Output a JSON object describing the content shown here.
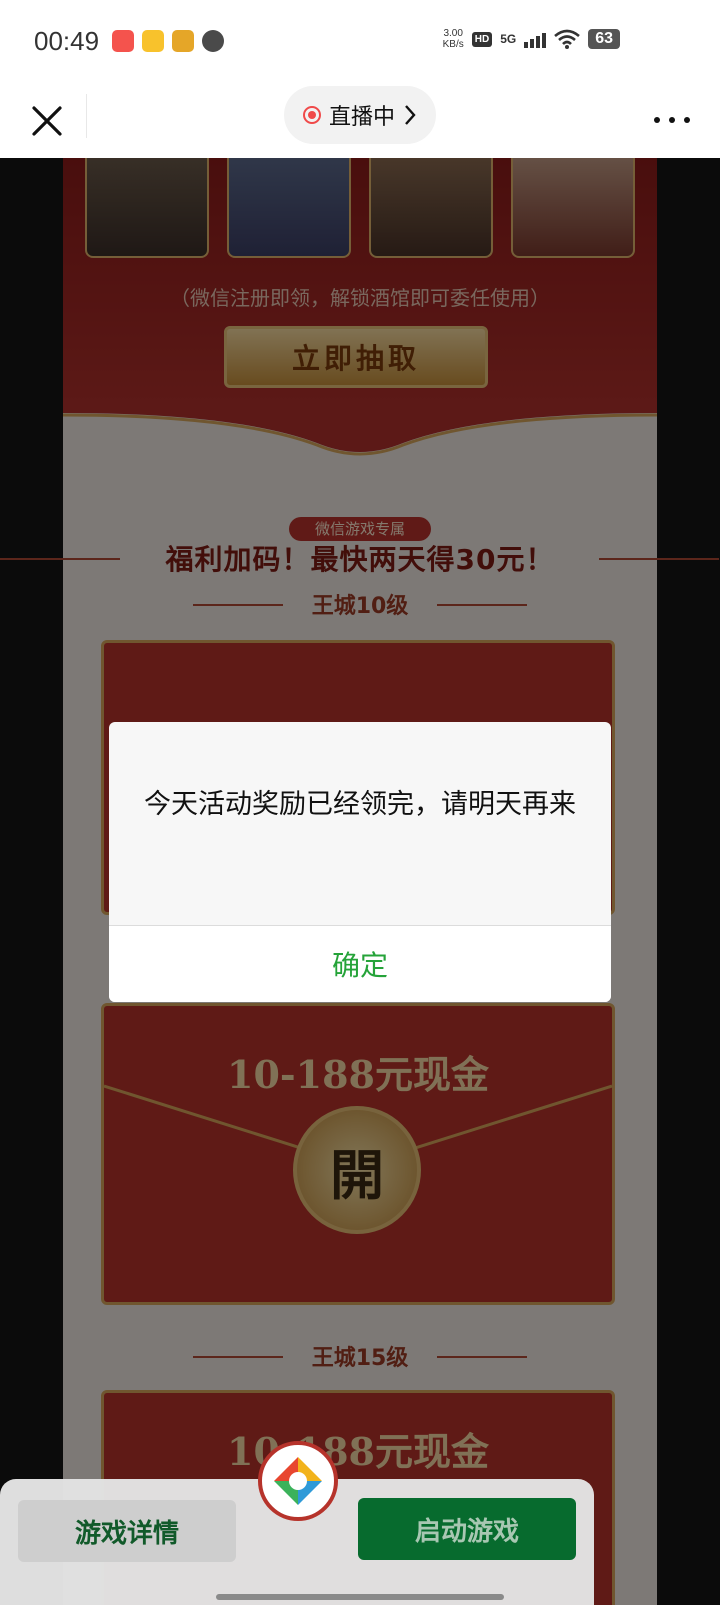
{
  "status_bar": {
    "time": "00:49",
    "net_speed_value": "3.00",
    "net_speed_unit": "KB/s",
    "hd_label": "HD",
    "network": "5G",
    "battery": "63"
  },
  "nav": {
    "live_label": "直播中",
    "live_chevron": "›"
  },
  "page": {
    "register_note": "（微信注册即领，解锁酒馆即可委任使用）",
    "draw_button": "立即抽取",
    "exclusive_badge": "微信游戏专属",
    "bonus_title": "福利加码！最快两天得30元！",
    "level_10": "王城10级",
    "cash_title": "10-188元现金",
    "open_label": "開",
    "level_15": "王城15级",
    "cash_title_2": "10-188元现金"
  },
  "dialog": {
    "message": "今天活动奖励已经领完，请明天再来",
    "confirm": "确定"
  },
  "bottom": {
    "detail_button": "游戏详情",
    "launch_button": "启动游戏"
  },
  "colors": {
    "accent_green": "#25a339",
    "launch_green": "#076b2e",
    "banner_red": "#b6332b",
    "gold": "#d7a65b"
  }
}
